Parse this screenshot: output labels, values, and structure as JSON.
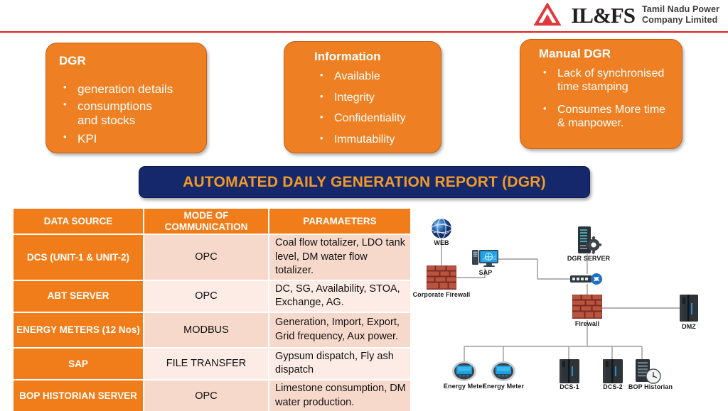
{
  "header": {
    "logo_word": "IL&FS",
    "logo_icon": "ilfs-triangle-logo",
    "company_line1": "Tamil Nadu Power",
    "company_line2": "Company Limited",
    "rule_color": "#e01b22"
  },
  "boxes": [
    {
      "id": "dgr",
      "title": "DGR",
      "items": [
        "generation details",
        "consumptions\nand stocks",
        "KPI"
      ]
    },
    {
      "id": "information",
      "title": "Information",
      "items": [
        "Available",
        "Integrity",
        "Confidentiality",
        "Immutability"
      ]
    },
    {
      "id": "manual-dgr",
      "title": "Manual DGR",
      "items": [
        "Lack of synchronised time stamping",
        " Consumes More time & manpower."
      ]
    }
  ],
  "banner": {
    "text": "AUTOMATED DAILY GENERATION REPORT (DGR)",
    "bg_color": "#15286b",
    "text_color": "#f09a28"
  },
  "table": {
    "headers": [
      "DATA SOURCE",
      "MODE OF\nCOMMUNICATION",
      "PARAMAETERS"
    ],
    "header_bg": "#f07d1a",
    "rows": [
      {
        "source": "DCS (UNIT-1 & UNIT-2)",
        "mode": "OPC",
        "parameters": "Coal flow totalizer, LDO tank level, DM water flow totalizer."
      },
      {
        "source": "ABT SERVER",
        "mode": "OPC",
        "parameters": "DC, SG, Availability, STOA, Exchange, AG."
      },
      {
        "source": "ENERGY METERS (12 Nos)",
        "mode": "MODBUS",
        "parameters": "Generation, Import, Export, Grid frequency, Aux power."
      },
      {
        "source": "SAP",
        "mode": "FILE TRANSFER",
        "parameters": "Gypsum dispatch, Fly ash dispatch"
      },
      {
        "source": "BOP HISTORIAN SERVER",
        "mode": "OPC",
        "parameters": "Limestone consumption, DM water production."
      }
    ]
  },
  "network_diagram": {
    "nodes": [
      {
        "id": "web",
        "label": "WEB",
        "icon": "globe-icon"
      },
      {
        "id": "corporate-firewall",
        "label": "Corporate Firewall",
        "icon": "brick-wall-icon"
      },
      {
        "id": "sap",
        "label": "SAP",
        "icon": "desktop-computer-icon"
      },
      {
        "id": "dgr-server",
        "label": "DGR SERVER",
        "icon": "server-gear-icon"
      },
      {
        "id": "switch",
        "label": "",
        "icon": "network-switch-icon"
      },
      {
        "id": "firewall",
        "label": "Firewall",
        "icon": "brick-wall-icon"
      },
      {
        "id": "dmz",
        "label": "DMZ",
        "icon": "server-tower-icon"
      },
      {
        "id": "energy-meter-1",
        "label": "Energy Meter",
        "icon": "energy-meter-icon"
      },
      {
        "id": "energy-meter-2",
        "label": "Energy Meter",
        "icon": "energy-meter-icon"
      },
      {
        "id": "dcs-1",
        "label": "DCS-1",
        "icon": "server-tower-icon"
      },
      {
        "id": "dcs-2",
        "label": "DCS-2",
        "icon": "server-tower-icon"
      },
      {
        "id": "bop-historian",
        "label": "BOP Historian",
        "icon": "historian-clock-icon"
      }
    ],
    "line_color": "#9a9a9a"
  }
}
